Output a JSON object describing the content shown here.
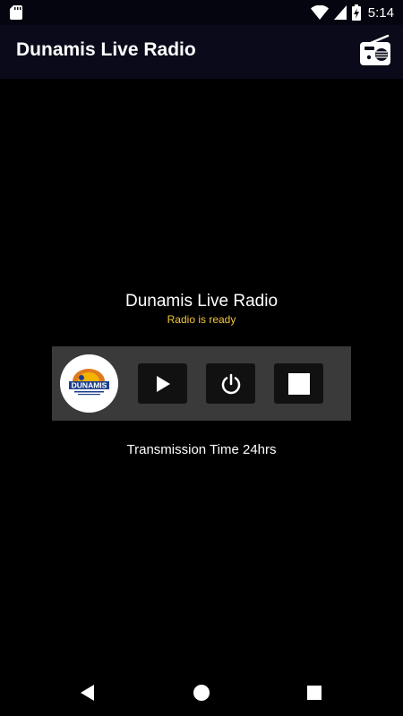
{
  "status_bar": {
    "time": "5:14",
    "icons": [
      "sd-card-icon",
      "wifi-icon",
      "cell-signal-icon",
      "battery-charging-icon"
    ]
  },
  "app_bar": {
    "title": "Dunamis Live Radio",
    "action_icon": "radio-icon"
  },
  "player": {
    "station_name": "Dunamis Live Radio",
    "status": "Radio is ready",
    "logo_text": "DUNAMIS",
    "buttons": [
      {
        "name": "play",
        "icon": "play-icon"
      },
      {
        "name": "power",
        "icon": "power-icon"
      },
      {
        "name": "stop",
        "icon": "stop-icon"
      }
    ]
  },
  "info": {
    "transmission_time": "Transmission Time 24hrs"
  },
  "nav_bar": {
    "buttons": [
      "back-icon",
      "home-icon",
      "recents-icon"
    ]
  },
  "colors": {
    "background": "#000000",
    "app_bar": "#0a0a1a",
    "status_text": "#f2c53d",
    "panel": "#3a3a3a",
    "button": "#111111"
  }
}
